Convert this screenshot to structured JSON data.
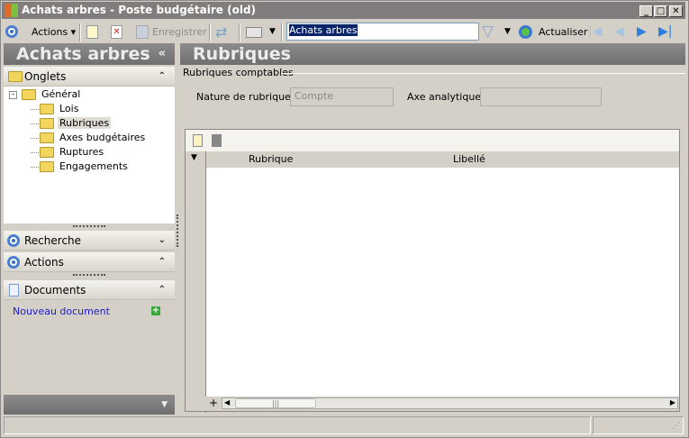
{
  "window": {
    "title": "Achats arbres -  Poste budgétaire (old)",
    "min": "_",
    "max": "□",
    "close": "✕"
  },
  "toolbar": {
    "actions": "Actions",
    "save": "Enregistrer",
    "search_value": "Achats arbres",
    "refresh": "Actualiser"
  },
  "left": {
    "header": "Achats arbres",
    "collapse": "«",
    "onglets": "Onglets",
    "tree": {
      "root": "Général",
      "children": [
        "Lois",
        "Rubriques",
        "Axes budgétaires",
        "Ruptures",
        "Engagements"
      ],
      "selected": "Rubriques"
    },
    "recherche": "Recherche",
    "actions": "Actions",
    "documents": "Documents",
    "new_document": "Nouveau document"
  },
  "right": {
    "header": "Rubriques",
    "group": "Rubriques comptables",
    "nature_label": "Nature de rubrique :",
    "nature_value": "Compte",
    "axe_label": "Axe analytique :",
    "axe_value": "",
    "columns": [
      "Rubrique",
      "Libellé"
    ],
    "add": "+"
  }
}
